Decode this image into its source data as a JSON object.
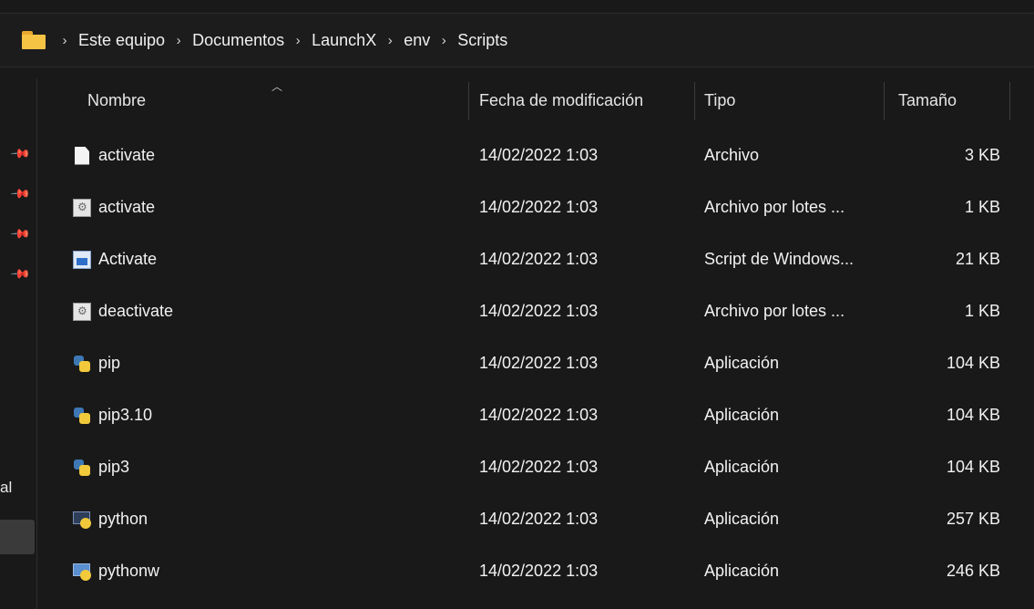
{
  "breadcrumb": {
    "items": [
      "Este equipo",
      "Documentos",
      "LaunchX",
      "env",
      "Scripts"
    ]
  },
  "nav": {
    "partial_label": "al"
  },
  "columns": {
    "name": "Nombre",
    "date": "Fecha de modificación",
    "type": "Tipo",
    "size": "Tamaño"
  },
  "files": [
    {
      "icon": "file-icon",
      "name": "activate",
      "date": "14/02/2022 1:03",
      "type": "Archivo",
      "size": "3 KB"
    },
    {
      "icon": "batch-file-icon",
      "name": "activate",
      "date": "14/02/2022 1:03",
      "type": "Archivo por lotes ...",
      "size": "1 KB"
    },
    {
      "icon": "powershell-script-icon",
      "name": "Activate",
      "date": "14/02/2022 1:03",
      "type": "Script de Windows...",
      "size": "21 KB"
    },
    {
      "icon": "batch-file-icon",
      "name": "deactivate",
      "date": "14/02/2022 1:03",
      "type": "Archivo por lotes ...",
      "size": "1 KB"
    },
    {
      "icon": "python-app-icon",
      "name": "pip",
      "date": "14/02/2022 1:03",
      "type": "Aplicación",
      "size": "104 KB"
    },
    {
      "icon": "python-app-icon",
      "name": "pip3.10",
      "date": "14/02/2022 1:03",
      "type": "Aplicación",
      "size": "104 KB"
    },
    {
      "icon": "python-app-icon",
      "name": "pip3",
      "date": "14/02/2022 1:03",
      "type": "Aplicación",
      "size": "104 KB"
    },
    {
      "icon": "python-console-icon",
      "name": "python",
      "date": "14/02/2022 1:03",
      "type": "Aplicación",
      "size": "257 KB"
    },
    {
      "icon": "python-window-icon",
      "name": "pythonw",
      "date": "14/02/2022 1:03",
      "type": "Aplicación",
      "size": "246 KB"
    }
  ],
  "colors": {
    "background": "#191919",
    "text": "#f2f2f2",
    "folder": "#f6c445"
  }
}
